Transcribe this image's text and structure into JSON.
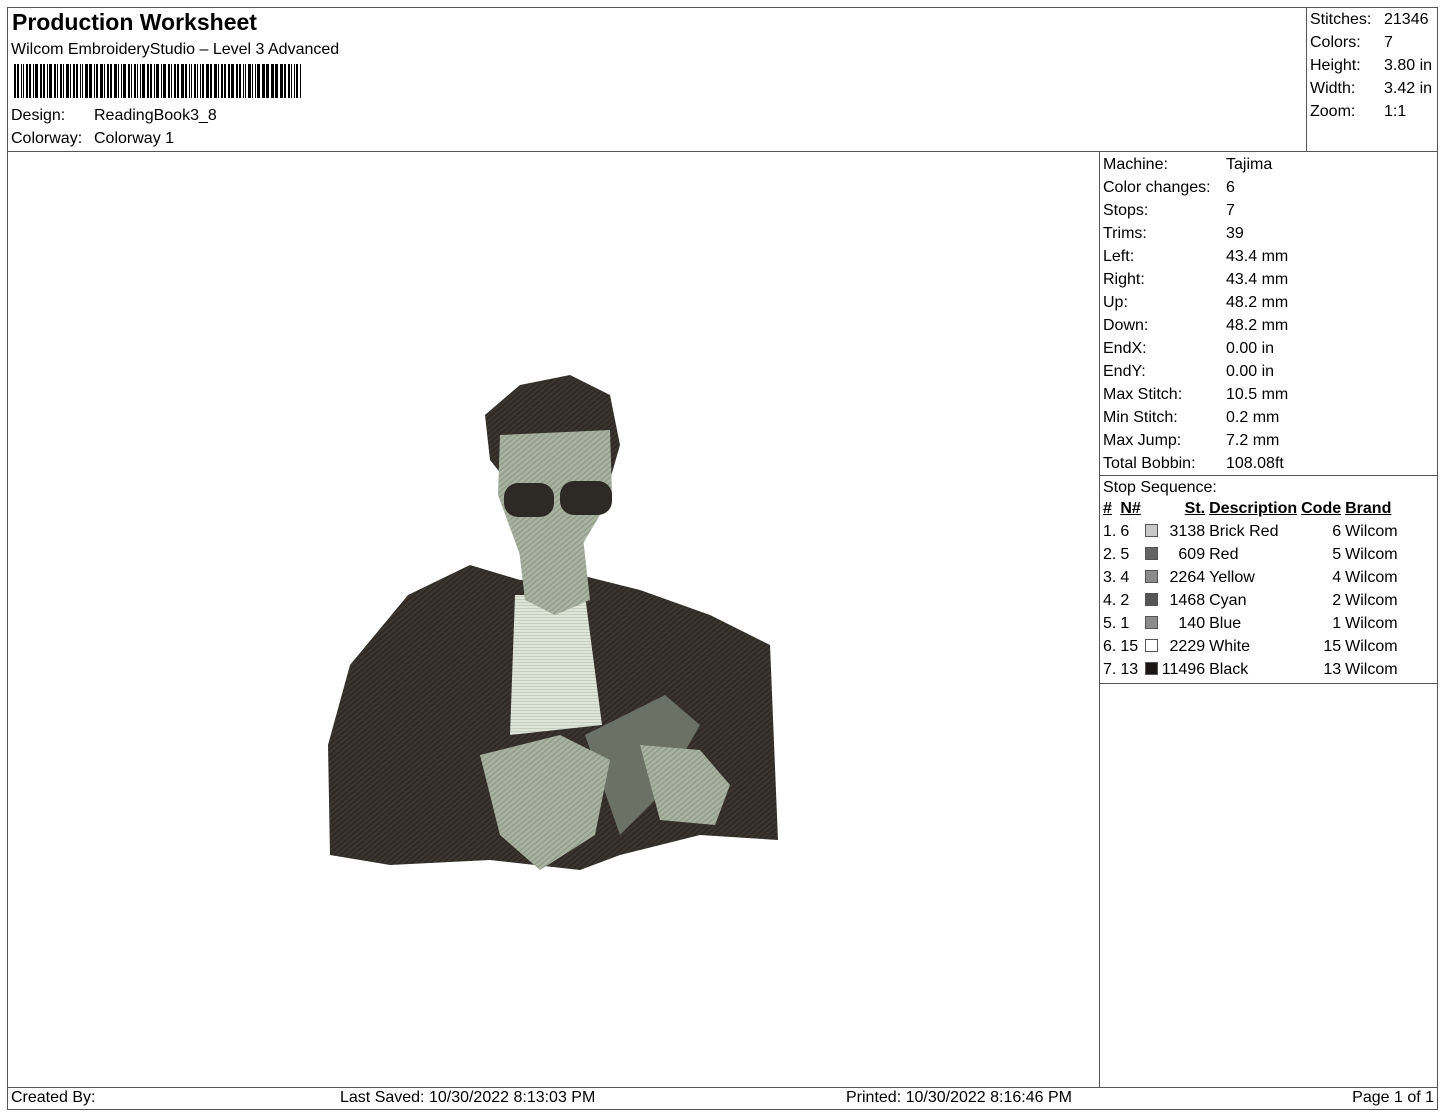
{
  "header": {
    "title": "Production Worksheet",
    "subtitle": "Wilcom EmbroideryStudio – Level 3 Advanced",
    "design_label": "Design:",
    "design_value": "ReadingBook3_8",
    "colorway_label": "Colorway:",
    "colorway_value": "Colorway 1"
  },
  "stats": [
    {
      "k": "Stitches:",
      "v": "21346"
    },
    {
      "k": "Colors:",
      "v": "7"
    },
    {
      "k": "Height:",
      "v": "3.80 in"
    },
    {
      "k": "Width:",
      "v": "3.42 in"
    },
    {
      "k": "Zoom:",
      "v": "1:1"
    }
  ],
  "info": [
    {
      "k": "Machine:",
      "v": "Tajima"
    },
    {
      "k": "Color changes:",
      "v": "6"
    },
    {
      "k": "Stops:",
      "v": "7"
    },
    {
      "k": "Trims:",
      "v": "39"
    },
    {
      "k": "Left:",
      "v": "43.4 mm"
    },
    {
      "k": "Right:",
      "v": "43.4 mm"
    },
    {
      "k": "Up:",
      "v": "48.2 mm"
    },
    {
      "k": "Down:",
      "v": "48.2 mm"
    },
    {
      "k": "EndX:",
      "v": "0.00 in"
    },
    {
      "k": "EndY:",
      "v": "0.00 in"
    },
    {
      "k": "Max Stitch:",
      "v": "10.5 mm"
    },
    {
      "k": "Min Stitch:",
      "v": "0.2 mm"
    },
    {
      "k": "Max Jump:",
      "v": "7.2 mm"
    },
    {
      "k": "Total Bobbin:",
      "v": "108.08ft"
    }
  ],
  "stop_sequence": {
    "label": "Stop Sequence:",
    "headers": [
      "#",
      "N#",
      "St.",
      "Description",
      "Code",
      "Brand"
    ],
    "rows": [
      {
        "n": "1.",
        "needle": "6",
        "color": "#c8c8c8",
        "st": "3138",
        "desc": "Brick Red",
        "code": "6",
        "brand": "Wilcom"
      },
      {
        "n": "2.",
        "needle": "5",
        "color": "#646464",
        "st": "609",
        "desc": "Red",
        "code": "5",
        "brand": "Wilcom"
      },
      {
        "n": "3.",
        "needle": "4",
        "color": "#8a8a8a",
        "st": "2264",
        "desc": "Yellow",
        "code": "4",
        "brand": "Wilcom"
      },
      {
        "n": "4.",
        "needle": "2",
        "color": "#555555",
        "st": "1468",
        "desc": "Cyan",
        "code": "2",
        "brand": "Wilcom"
      },
      {
        "n": "5.",
        "needle": "1",
        "color": "#8c8c8c",
        "st": "140",
        "desc": "Blue",
        "code": "1",
        "brand": "Wilcom"
      },
      {
        "n": "6.",
        "needle": "15",
        "color": "#ffffff",
        "st": "2229",
        "desc": "White",
        "code": "15",
        "brand": "Wilcom"
      },
      {
        "n": "7.",
        "needle": "13",
        "color": "#1c1616",
        "st": "11496",
        "desc": "Black",
        "code": "13",
        "brand": "Wilcom"
      }
    ]
  },
  "footer": {
    "created": "Created By:",
    "saved": "Last Saved: 10/30/2022 8:13:03 PM",
    "printed": "Printed: 10/30/2022 8:16:46 PM",
    "page": "Page 1 of 1"
  }
}
